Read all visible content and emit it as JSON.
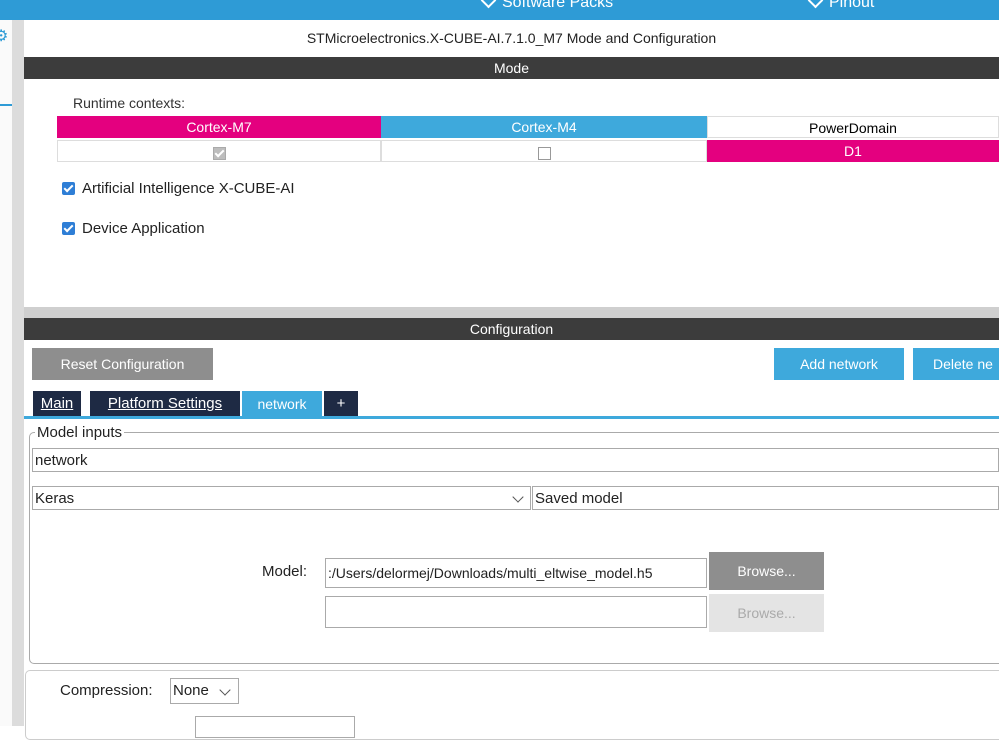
{
  "topbar": {
    "software_packs": "Software Packs",
    "pinout": "Pinout"
  },
  "title": "STMicroelectronics.X-CUBE-AI.7.1.0_M7 Mode and Configuration",
  "mode": {
    "section_title": "Mode",
    "runtime_label": "Runtime contexts:",
    "columns": [
      "Cortex-M7",
      "Cortex-M4",
      "PowerDomain"
    ],
    "power_domain_value": "D1",
    "cortex_m7_checked": true,
    "cortex_m4_checked": false,
    "checkbox_ai": "Artificial Intelligence X-CUBE-AI",
    "checkbox_app": "Device Application"
  },
  "configuration": {
    "section_title": "Configuration",
    "reset_button": "Reset Configuration",
    "add_network_button": "Add network",
    "delete_network_button": "Delete ne",
    "tabs": [
      "Main",
      "Platform Settings",
      "network",
      "+"
    ],
    "model_inputs_legend": "Model inputs",
    "network_name": "network",
    "framework": "Keras",
    "model_type": "Saved model",
    "model_label": "Model:",
    "model_path": ":/Users/delormej/Downloads/multi_eltwise_model.h5",
    "browse_button": "Browse...",
    "browse_button_2": "Browse...",
    "compression_label": "Compression:",
    "compression_value": "None"
  },
  "colors": {
    "accent_blue": "#2e9bd6",
    "magenta": "#e4007f",
    "dark_header": "#3c3c3c"
  }
}
